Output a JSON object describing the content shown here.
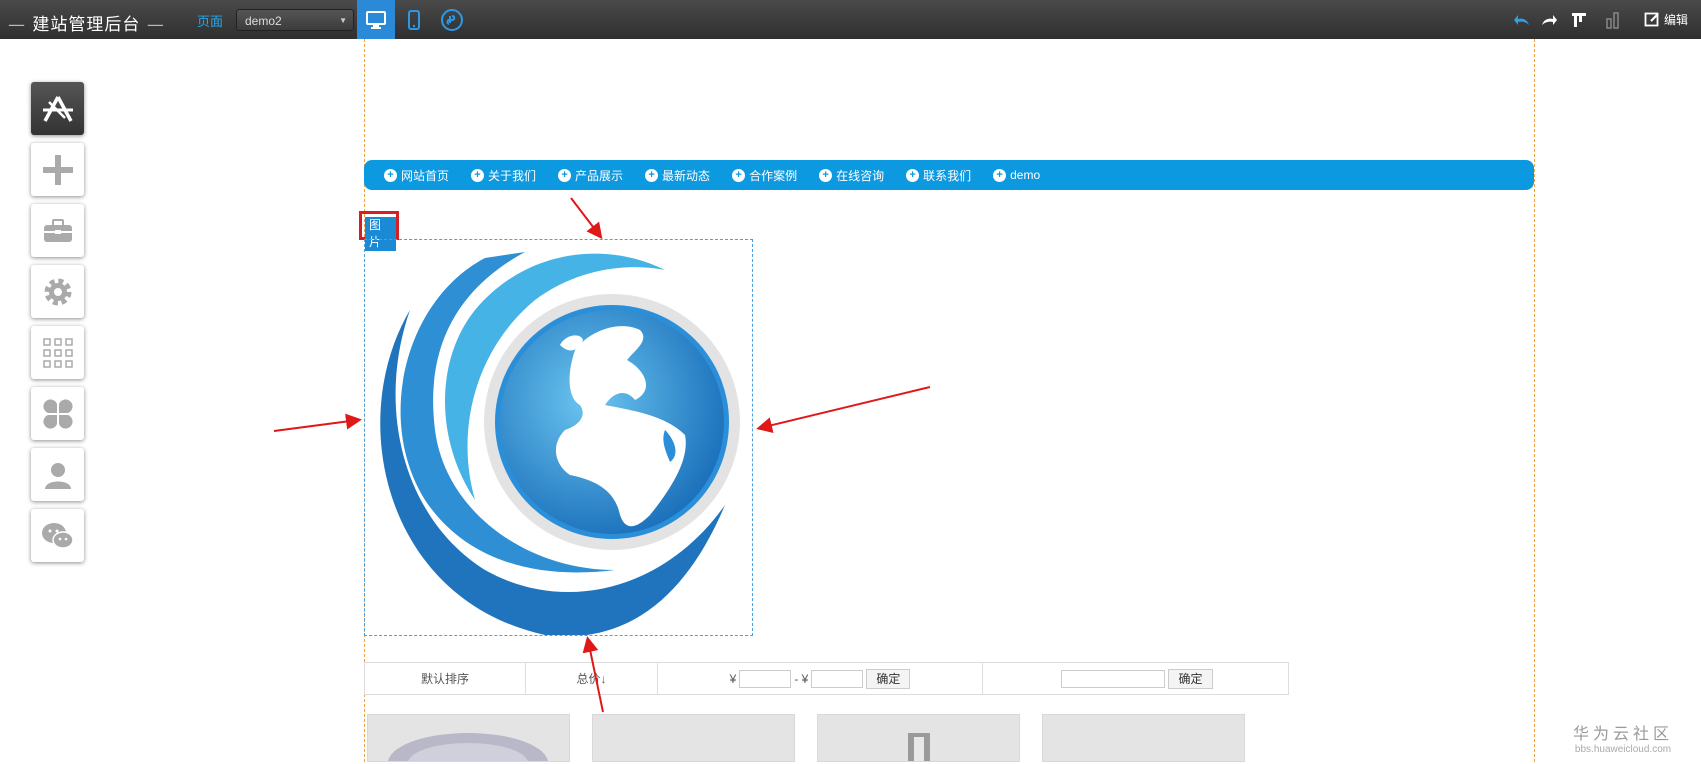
{
  "header": {
    "title": "建站管理后台",
    "page_label": "页面",
    "page_select_value": "demo2",
    "edit_label": "编辑"
  },
  "navbar": {
    "items": [
      "网站首页",
      "关于我们",
      "产品展示",
      "最新动态",
      "合作案例",
      "在线咨询",
      "联系我们",
      "demo"
    ]
  },
  "image_widget": {
    "tag_label": "图片"
  },
  "filter_bar": {
    "sort_default": "默认排序",
    "sort_total": "总价",
    "sort_total_arrow": "↓",
    "currency": "¥",
    "range_sep": "-",
    "confirm_label": "确定",
    "search_confirm_label": "确定"
  },
  "watermark": {
    "line1": "华为云社区",
    "line2": "bbs.huaweicloud.com"
  },
  "colors": {
    "accent": "#0d99e0",
    "annotation_red": "#d41f27",
    "topbar": "#3a3a3a"
  }
}
